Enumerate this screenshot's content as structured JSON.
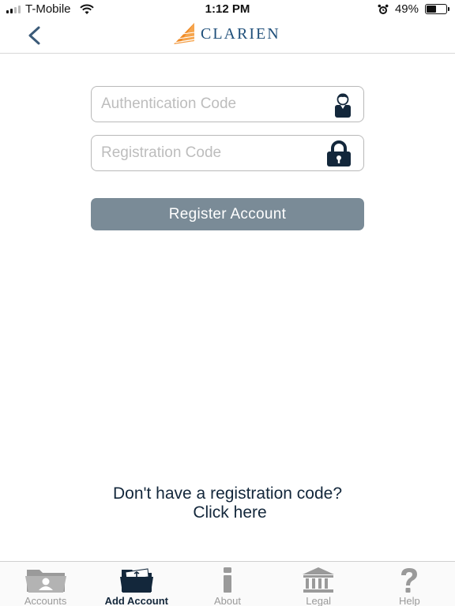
{
  "status_bar": {
    "carrier": "T-Mobile",
    "time": "1:12 PM",
    "battery_percent": "49%",
    "battery_level": 0.49
  },
  "header": {
    "brand": "CLARIEN",
    "back_icon": "chevron-left-icon"
  },
  "form": {
    "auth_placeholder": "Authentication Code",
    "auth_value": "",
    "reg_placeholder": "Registration Code",
    "reg_value": "",
    "register_label": "Register Account"
  },
  "help": {
    "question": "Don't have a registration code?",
    "link": "Click here"
  },
  "tabs": [
    {
      "label": "Accounts",
      "icon": "accounts-folder-icon",
      "active": false
    },
    {
      "label": "Add Account",
      "icon": "add-account-folder-icon",
      "active": true
    },
    {
      "label": "About",
      "icon": "info-icon",
      "active": false
    },
    {
      "label": "Legal",
      "icon": "courthouse-icon",
      "active": false
    },
    {
      "label": "Help",
      "icon": "question-mark-icon",
      "active": false
    }
  ],
  "colors": {
    "brand_blue": "#1f4f7a",
    "brand_orange": "#f08a24",
    "button_gray": "#7a8b97",
    "icon_navy": "#13273b",
    "inactive_gray": "#9a9a9a"
  }
}
